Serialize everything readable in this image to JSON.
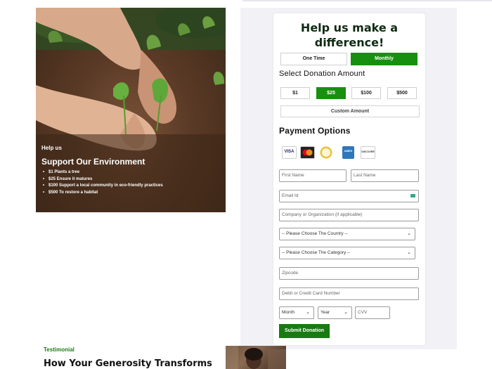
{
  "hero": {
    "eyebrow": "Help us",
    "title": "Support Our Environment",
    "benefits": [
      "$1 Plants a tree",
      "$25 Ensure it matures",
      "$100 Support a local community in eco-friendly practices",
      "$500 To restore a habitat"
    ]
  },
  "form": {
    "title": "Help us make a difference!",
    "frequency": [
      {
        "label": "One Time",
        "active": false
      },
      {
        "label": "Monthly",
        "active": true
      }
    ],
    "amount_heading": "Select Donation Amount",
    "amounts": [
      {
        "label": "$1",
        "active": false
      },
      {
        "label": "$25",
        "active": true
      },
      {
        "label": "$100",
        "active": false
      },
      {
        "label": "$500",
        "active": false
      }
    ],
    "custom_amount_label": "Custom Amount",
    "payment_heading": "Payment Options",
    "payment_icons": [
      "visa-icon",
      "mastercard-icon",
      "authorize-net-icon",
      "amex-icon",
      "discover-icon"
    ],
    "payment_icon_labels": {
      "visa": "VISA",
      "amex": "AMEX",
      "discover": "DISCOVER"
    },
    "fields": {
      "first_name": "First Name",
      "last_name": "Last Name",
      "email": "Email Id",
      "company": "Company or Organization (if applicable)",
      "country": "-- Please Choose The Country --",
      "category": "-- Please Choose The Category --",
      "zipcode": "Zipcode",
      "card": "Debit or Credit Card Number",
      "month": "Month",
      "year": "Year",
      "cvv": "CVV"
    },
    "submit_label": "Submit Donation"
  },
  "testimonial": {
    "tag": "Testimonial",
    "heading": "How Your Generosity Transforms"
  },
  "colors": {
    "accent": "#18900f",
    "heading": "#0f2a12",
    "panel_bg": "#f2f1f6"
  }
}
